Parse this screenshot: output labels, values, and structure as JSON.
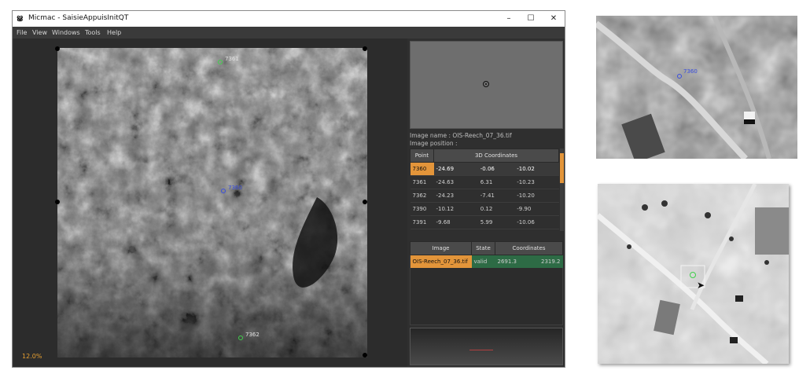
{
  "window": {
    "title": "Micmac - SaisieAppuisInitQT",
    "logo": "ൠ",
    "controls": {
      "minimize": "–",
      "maximize": "☐",
      "close": "✕"
    }
  },
  "menu": [
    "File",
    "View",
    "Windows",
    "Tools",
    "Help"
  ],
  "viewer": {
    "zoom": "12.0%",
    "points": [
      {
        "id": "7360",
        "color": "#3a4fe0",
        "kind": "circle"
      },
      {
        "id": "7361",
        "color": "#3fd04a",
        "kind": "cross"
      },
      {
        "id": "7362",
        "color": "#3fd04a",
        "kind": "cross"
      }
    ]
  },
  "panel": {
    "image_name": "Image name : OIS-Reech_07_36.tif",
    "image_position": "Image position :",
    "points_table": {
      "headers": [
        "Point",
        "3D Coordinates"
      ],
      "rows": [
        {
          "point": "7360",
          "x": "-24.69",
          "y": "-0.06",
          "z": "-10.02",
          "selected": true
        },
        {
          "point": "7361",
          "x": "-24.63",
          "y": "6.31",
          "z": "-10.23"
        },
        {
          "point": "7362",
          "x": "-24.23",
          "y": "-7.41",
          "z": "-10.20"
        },
        {
          "point": "7390",
          "x": "-10.12",
          "y": "0.12",
          "z": "-9.90"
        },
        {
          "point": "7391",
          "x": "-9.68",
          "y": "5.99",
          "z": "-10.06"
        }
      ]
    },
    "images_table": {
      "headers": [
        "Image",
        "State",
        "Coordinates"
      ],
      "row": {
        "image": "OIS-Reech_07_36.tif",
        "state": "valid",
        "cx": "2691.3",
        "cy": "2319.2"
      }
    }
  },
  "crops": {
    "top_label": "7360",
    "top_label_color": "#3a4fe0",
    "bottom_marker_color": "#3fd04a"
  }
}
